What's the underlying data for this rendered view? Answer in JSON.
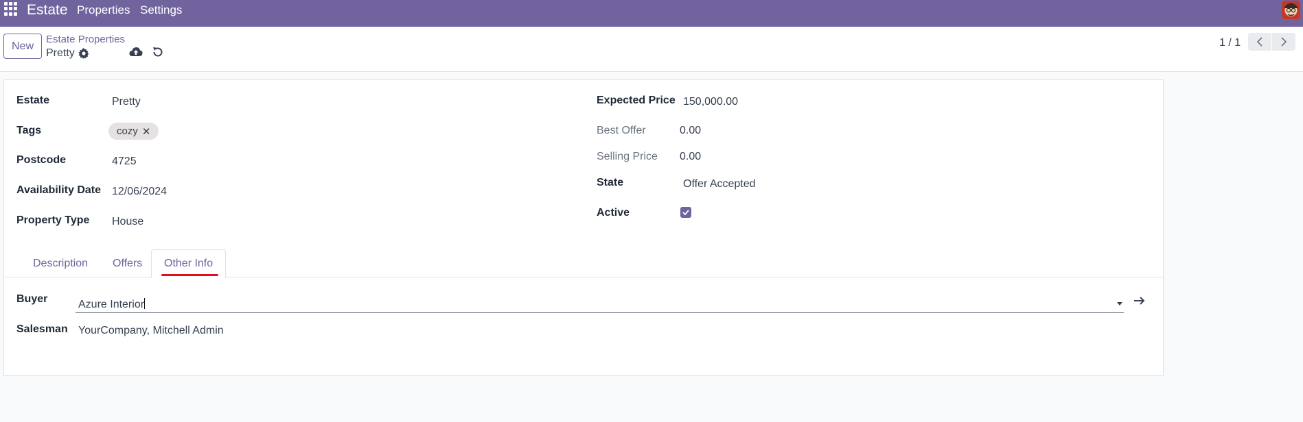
{
  "navbar": {
    "brand": "Estate",
    "menu": [
      "Properties",
      "Settings"
    ]
  },
  "control_panel": {
    "new_label": "New",
    "breadcrumb": "Estate Properties",
    "record_name": "Pretty",
    "pager": "1 / 1"
  },
  "form": {
    "estate": {
      "label": "Estate",
      "value": "Pretty"
    },
    "tags": {
      "label": "Tags",
      "items": [
        "cozy"
      ]
    },
    "postcode": {
      "label": "Postcode",
      "value": "4725"
    },
    "availability_date": {
      "label": "Availability Date",
      "value": "12/06/2024"
    },
    "property_type": {
      "label": "Property Type",
      "value": "House"
    },
    "expected_price": {
      "label": "Expected Price",
      "value": "150,000.00"
    },
    "best_offer": {
      "label": "Best Offer",
      "value": "0.00"
    },
    "selling_price": {
      "label": "Selling Price",
      "value": "0.00"
    },
    "state": {
      "label": "State",
      "value": "Offer Accepted"
    },
    "active": {
      "label": "Active",
      "checked": true
    }
  },
  "tabs": [
    {
      "label": "Description",
      "active": false
    },
    {
      "label": "Offers",
      "active": false
    },
    {
      "label": "Other Info",
      "active": true
    }
  ],
  "other_info": {
    "buyer": {
      "label": "Buyer",
      "value": "Azure Interior"
    },
    "salesman": {
      "label": "Salesman",
      "value": "YourCompany, Mitchell Admin"
    }
  },
  "colors": {
    "brand": "#71639e",
    "annotation": "#e3101b"
  },
  "icons": [
    "apps-grid-icon",
    "gear-icon",
    "cloud-upload-icon",
    "discard-icon",
    "chevron-left-icon",
    "chevron-right-icon",
    "tag-remove-icon",
    "check-icon",
    "caret-down-icon",
    "arrow-right-icon"
  ]
}
